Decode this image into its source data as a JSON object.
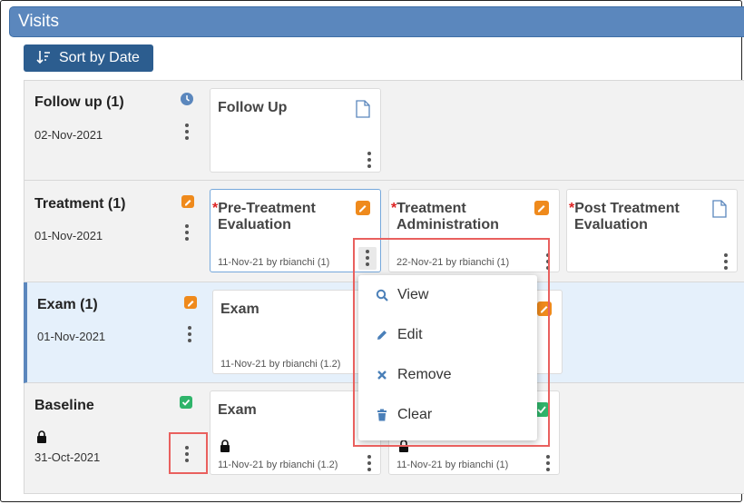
{
  "header": {
    "title": "Visits"
  },
  "toolbar": {
    "sort_label": "Sort by Date"
  },
  "rows": [
    {
      "title": "Follow up (1)",
      "date": "02-Nov-2021",
      "status_icon": "clock-icon",
      "cards": [
        {
          "title": "Follow Up",
          "icon": "document-icon",
          "meta": ""
        }
      ]
    },
    {
      "title": "Treatment (1)",
      "date": "01-Nov-2021",
      "status_icon": "edit-badge-icon",
      "cards": [
        {
          "title_line1": "Pre-Treatment",
          "title_line2": "Evaluation",
          "required": "*",
          "icon": "edit-badge-icon",
          "meta": "11-Nov-21 by rbianchi (1)"
        },
        {
          "title_line1": "Treatment",
          "title_line2": "Administration",
          "required": "*",
          "icon": "edit-badge-icon",
          "meta": "22-Nov-21 by rbianchi (1)"
        },
        {
          "title_line1": "Post Treatment",
          "title_line2": "Evaluation",
          "required": "*",
          "icon": "document-icon",
          "meta": ""
        }
      ]
    },
    {
      "title": "Exam (1)",
      "date": "01-Nov-2021",
      "status_icon": "edit-badge-icon",
      "cards": [
        {
          "title": "Exam",
          "icon": "check-badge-icon",
          "meta": "11-Nov-21 by rbianchi (1.2)"
        }
      ]
    },
    {
      "title": "Baseline",
      "date": "31-Oct-2021",
      "status_icon": "check-badge-icon",
      "cards": [
        {
          "title": "Exam",
          "icon": "check-badge-icon",
          "meta": "11-Nov-21 by rbianchi (1.2)"
        },
        {
          "title": "",
          "icon": "check-badge-icon",
          "meta": "11-Nov-21 by rbianchi (1)"
        }
      ]
    }
  ],
  "context_menu": {
    "items": [
      {
        "label": "View",
        "icon": "search-icon"
      },
      {
        "label": "Edit",
        "icon": "pencil-icon"
      },
      {
        "label": "Remove",
        "icon": "x-icon"
      },
      {
        "label": "Clear",
        "icon": "trash-icon"
      }
    ]
  },
  "colors": {
    "header": "#5b87bd",
    "button": "#2c5d8f",
    "orange": "#ef8a1c",
    "green": "#2fb46a",
    "highlight": "#e9605e"
  }
}
